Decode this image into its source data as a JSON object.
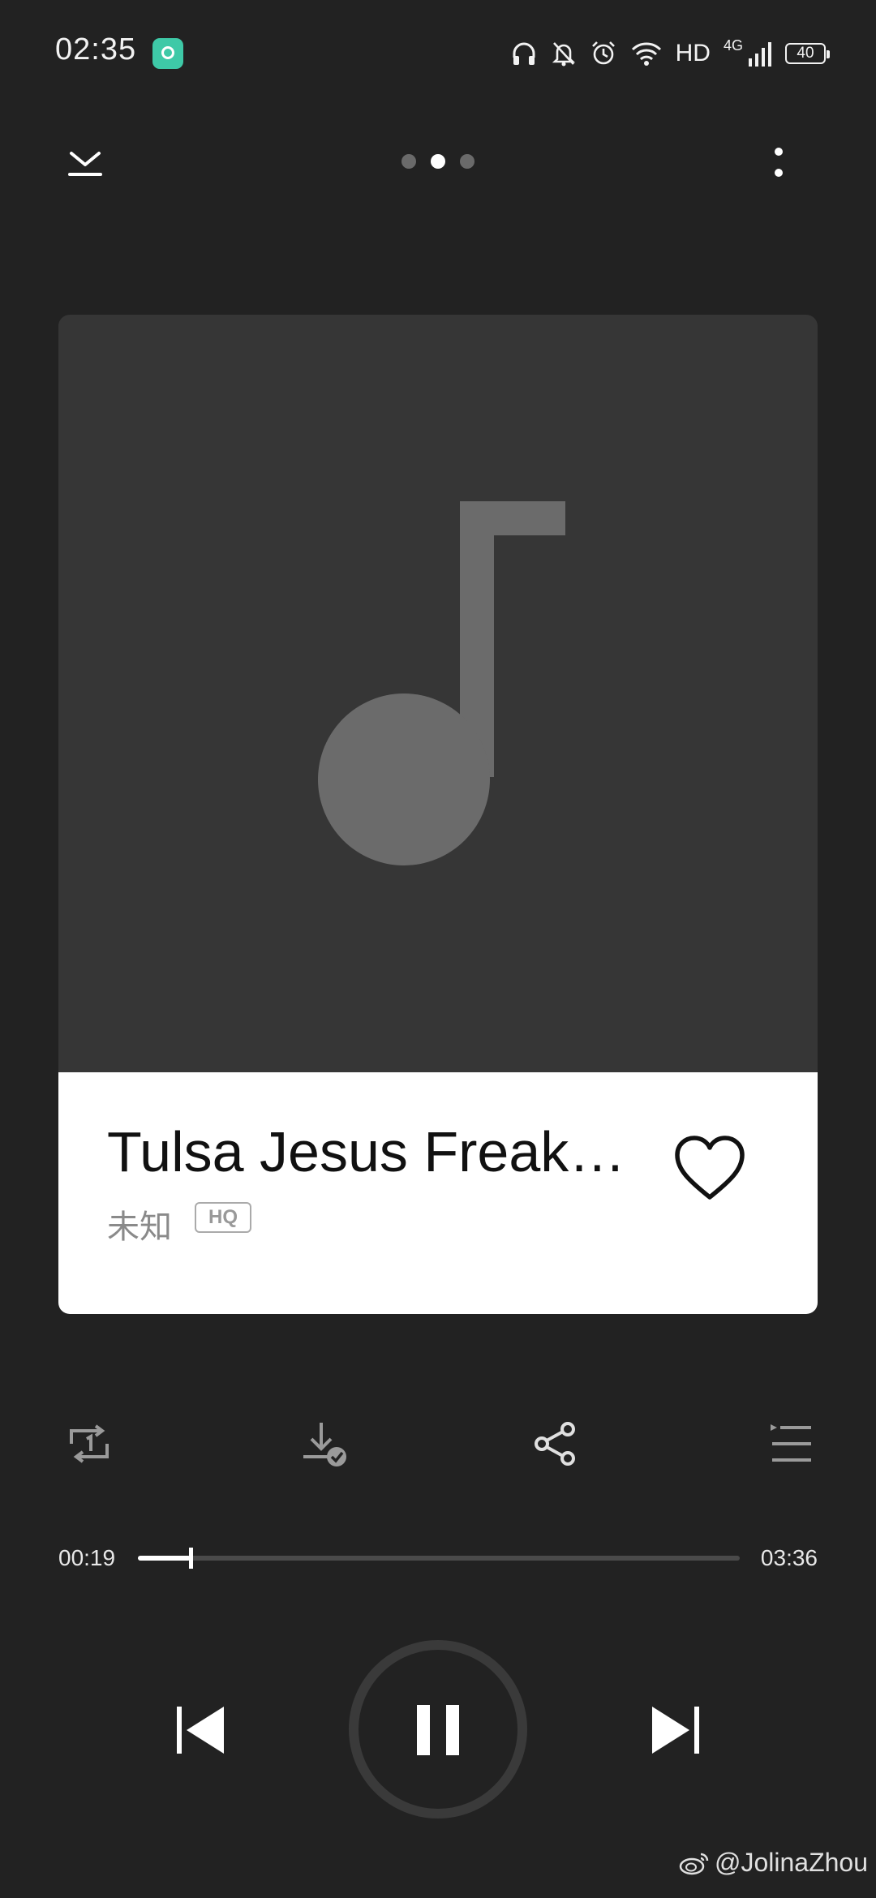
{
  "status_bar": {
    "time": "02:35",
    "app_icon": "music-app-icon",
    "icons": [
      "headphones-icon",
      "mute-bell-icon",
      "alarm-icon",
      "wifi-icon"
    ],
    "hd_label": "HD",
    "network_label": "4G",
    "battery_level": "40"
  },
  "top_bar": {
    "collapse_icon": "collapse-down-icon",
    "page_count": 3,
    "active_page": 2,
    "more_icon": "more-vertical-icon"
  },
  "cover": {
    "placeholder_icon": "music-note-icon"
  },
  "song": {
    "title": "Tulsa Jesus Freak…",
    "artist": "未知",
    "quality_badge": "HQ",
    "favorite_icon": "heart-outline-icon"
  },
  "actions": [
    {
      "name": "repeat-one-icon"
    },
    {
      "name": "downloaded-icon"
    },
    {
      "name": "share-icon"
    },
    {
      "name": "playlist-icon"
    }
  ],
  "progress": {
    "elapsed": "00:19",
    "total": "03:36",
    "fraction": 0.088
  },
  "controls": {
    "prev_icon": "skip-previous-icon",
    "pause_icon": "pause-icon",
    "next_icon": "skip-next-icon"
  },
  "watermark": {
    "text": "@JolinaZhou",
    "icon": "weibo-icon"
  },
  "colors": {
    "background": "#222222",
    "cover_bg": "#363636",
    "note": "#6b6b6b",
    "card": "#ffffff",
    "accent_app": "#3ec9a7"
  }
}
